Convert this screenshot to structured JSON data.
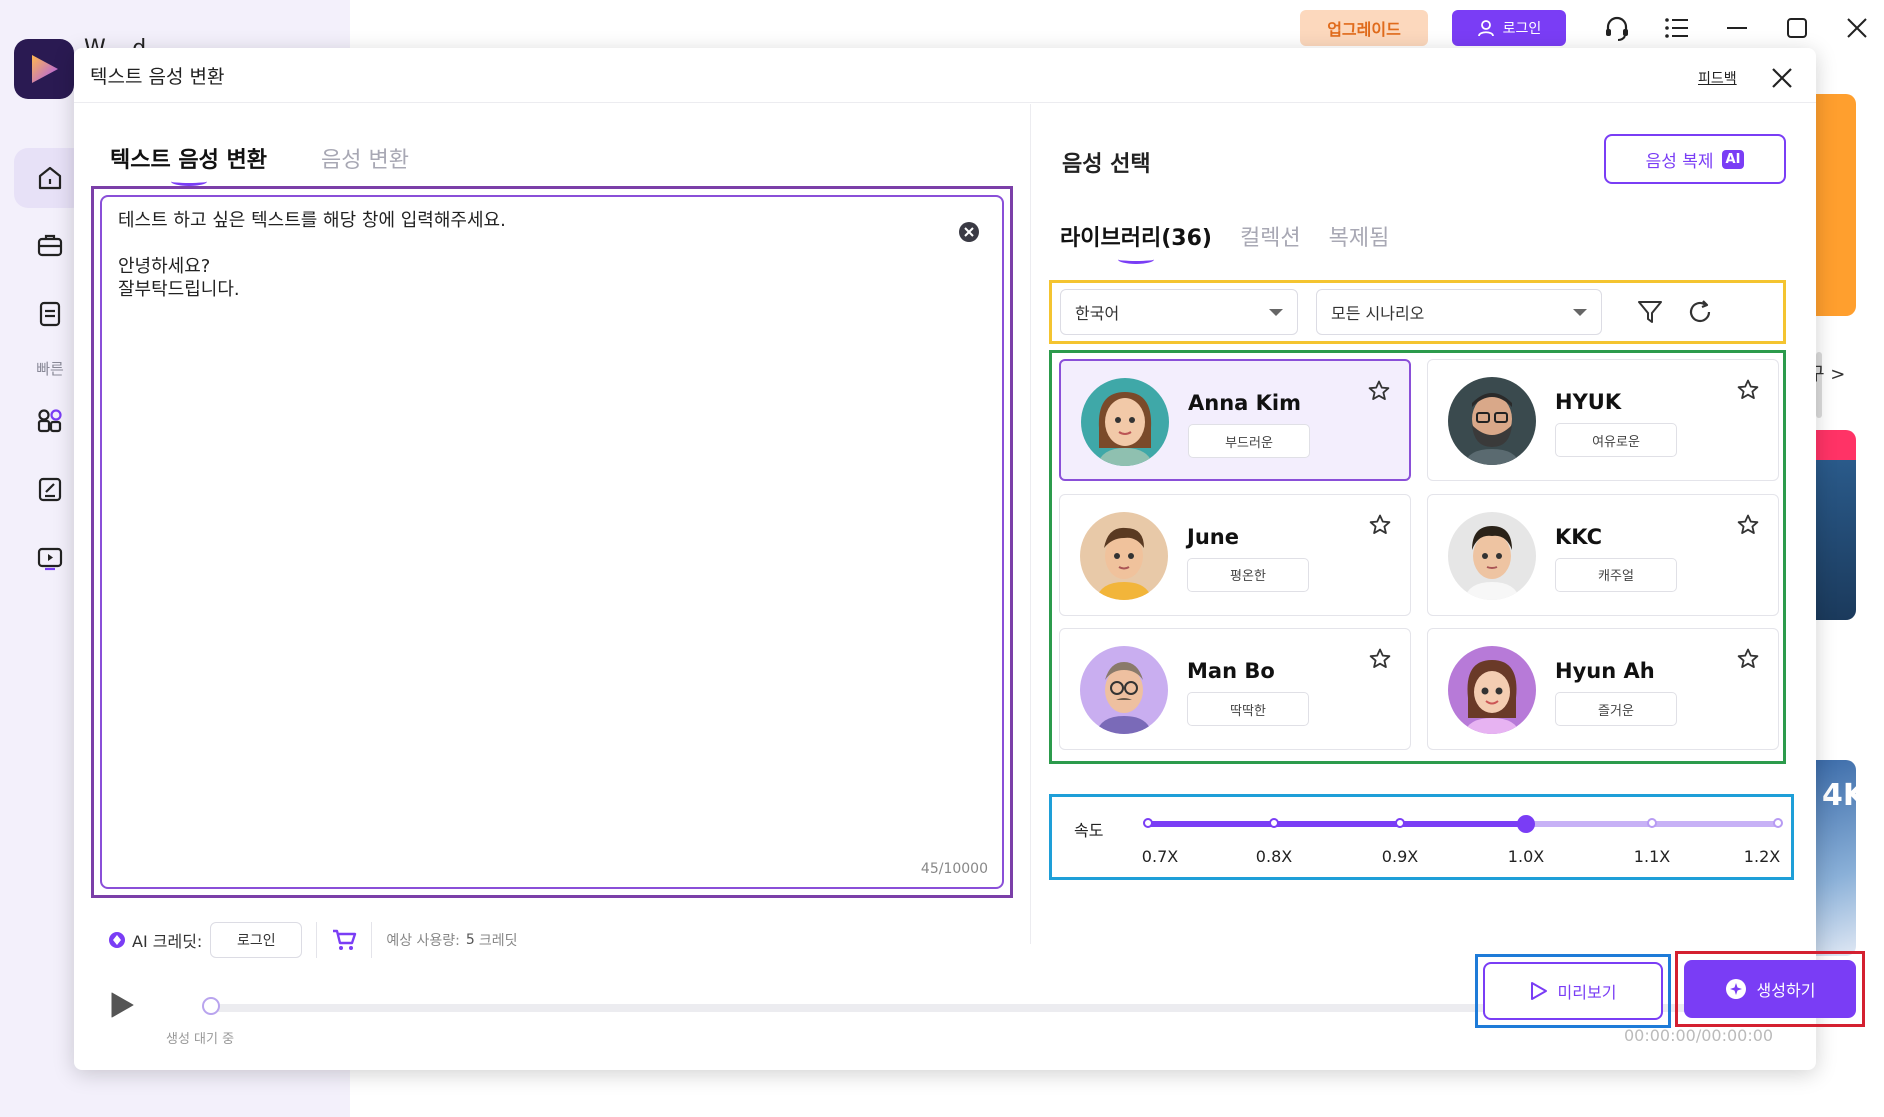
{
  "app": {
    "title": "W...d...",
    "nav": {
      "section_label": "빠른",
      "items": [
        {
          "icon": "home-icon"
        },
        {
          "icon": "toolbox-icon"
        },
        {
          "icon": "document-icon"
        },
        {
          "icon": "apps-icon"
        },
        {
          "icon": "edit-icon"
        },
        {
          "icon": "media-icon"
        }
      ]
    },
    "topbar": {
      "upgrade_label": "업그레이드",
      "login_label": "로그인"
    },
    "background": {
      "arrow_text": "구 >",
      "card_text": "4K"
    }
  },
  "dialog": {
    "title": "텍스트 음성 변환",
    "feedback_label": "피드백",
    "left": {
      "tabs": [
        {
          "label": "텍스트 음성 변환",
          "active": true
        },
        {
          "label": "음성 변환",
          "active": false
        }
      ],
      "text_value": "테스트 하고 싶은 텍스트를 해당 창에 입력해주세요.\n\n안녕하세요?\n잘부탁드립니다.",
      "char_count": "45/10000",
      "credits": {
        "label": "AI 크레딧:",
        "login_label": "로그인",
        "estimate_label": "예상 사용량:",
        "estimate_value": "5",
        "estimate_unit": "크레딧"
      },
      "player": {
        "status": "생성 대기 중",
        "time": "00:00:00/00:00:00",
        "progress": 0
      }
    },
    "right": {
      "title": "음성 선택",
      "clone_label": "음성 복제",
      "clone_badge": "AI",
      "tabs": [
        {
          "label": "라이브러리(36)",
          "active": true
        },
        {
          "label": "컬렉션",
          "active": false
        },
        {
          "label": "복제됨",
          "active": false
        }
      ],
      "filters": {
        "language": "한국어",
        "scenario": "모든 시나리오"
      },
      "voices": [
        {
          "name": "Anna Kim",
          "tag": "부드러운",
          "selected": true
        },
        {
          "name": "HYUK",
          "tag": "여유로운",
          "selected": false
        },
        {
          "name": "June",
          "tag": "평온한",
          "selected": false
        },
        {
          "name": "KKC",
          "tag": "캐주얼",
          "selected": false
        },
        {
          "name": "Man Bo",
          "tag": "딱딱한",
          "selected": false
        },
        {
          "name": "Hyun Ah",
          "tag": "즐거운",
          "selected": false
        }
      ],
      "speed": {
        "label": "속도",
        "ticks": [
          "0.7X",
          "0.8X",
          "0.9X",
          "1.0X",
          "1.1X",
          "1.2X"
        ],
        "value": "1.0X"
      },
      "preview_label": "미리보기",
      "generate_label": "생성하기"
    }
  },
  "colors": {
    "accent": "#7a3df5",
    "upgrade_bg": "#fcd8bd",
    "upgrade_text": "#e06b1c"
  }
}
